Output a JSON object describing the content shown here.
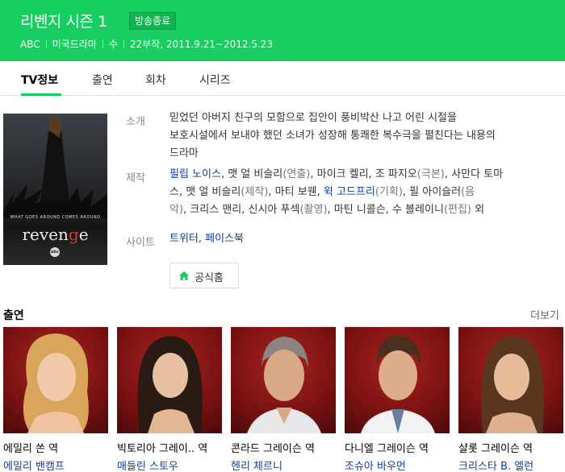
{
  "header": {
    "title": "리벤지 시즌 1",
    "badge": "방송종료",
    "meta": [
      "ABC",
      "미국드라마",
      "수",
      "22부작, 2011.9.21~2012.5.23"
    ],
    "color": "#19ce60"
  },
  "tabs": [
    {
      "label": "TV정보",
      "active": true
    },
    {
      "label": "출연",
      "active": false
    },
    {
      "label": "회차",
      "active": false
    },
    {
      "label": "시리즈",
      "active": false
    }
  ],
  "poster": {
    "tagline": "WHAT GOES AROUND COMES AROUND",
    "title_pre": "reven",
    "title_g": "g",
    "title_post": "e",
    "network": "abc"
  },
  "info": {
    "intro_label": "소개",
    "intro_lines": [
      "믿었던 아버지 친구의 모함으로 집안이 풍비박산 나고 어린 시절을",
      "보호시설에서 보내야 했던 소녀가 성장해 통쾌한 복수극을 펼친다는 내용의",
      "드라마"
    ],
    "production_label": "제작",
    "production": {
      "p1": "필립 노이스",
      "p2": ", 맷 얼 비슬리",
      "p3": "(연출)",
      "p4": ", 마이크 켈리, 조 파지오",
      "p5": "(극본)",
      "p6": ", 사만다 토마",
      "p7": "스, 맷 얼 비슬리",
      "p8": "(제작)",
      "p9": ", 마티 보웬, ",
      "p10": "윅 고드프리",
      "p11": "(기획)",
      "p12": ", 필 아이슬러",
      "p13": "(음",
      "p14": "악)",
      "p15": ", 크리스 맨리, 신시아 푸섹",
      "p16": "(촬영)",
      "p17": ", 마틴 니콜슨, 수 블레이니",
      "p18": "(편집)",
      "p19": " 외"
    },
    "site_label": "사이트",
    "sites": "트위터, 페이스북",
    "home_button": "공식홈"
  },
  "cast_section": {
    "title": "출연",
    "more": "더보기",
    "members": [
      {
        "role": "에밀리 쏜 역",
        "actor": "에밀리 밴캠프"
      },
      {
        "role": "빅토리아 그레이.. 역",
        "actor": "매들린 스토우"
      },
      {
        "role": "콘라드 그레이슨 역",
        "actor": "헨리 체르니"
      },
      {
        "role": "다니엘 그레이슨 역",
        "actor": "조슈아 바우먼"
      },
      {
        "role": "샬롯 그레이슨 역",
        "actor": "크리스타 B. 엘런"
      }
    ]
  }
}
